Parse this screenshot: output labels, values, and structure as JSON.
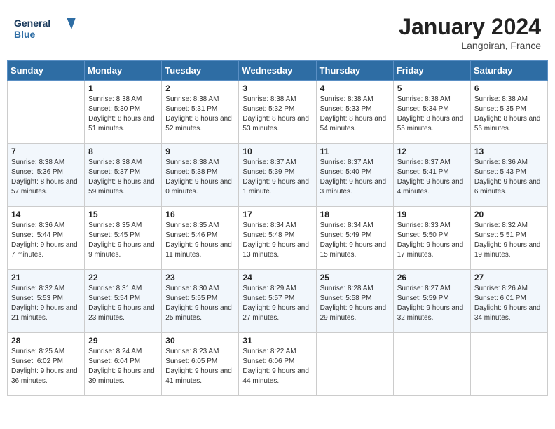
{
  "header": {
    "logo_line1": "General",
    "logo_line2": "Blue",
    "month": "January 2024",
    "location": "Langoiran, France"
  },
  "weekdays": [
    "Sunday",
    "Monday",
    "Tuesday",
    "Wednesday",
    "Thursday",
    "Friday",
    "Saturday"
  ],
  "weeks": [
    [
      {
        "day": "",
        "sunrise": "",
        "sunset": "",
        "daylight": ""
      },
      {
        "day": "1",
        "sunrise": "Sunrise: 8:38 AM",
        "sunset": "Sunset: 5:30 PM",
        "daylight": "Daylight: 8 hours and 51 minutes."
      },
      {
        "day": "2",
        "sunrise": "Sunrise: 8:38 AM",
        "sunset": "Sunset: 5:31 PM",
        "daylight": "Daylight: 8 hours and 52 minutes."
      },
      {
        "day": "3",
        "sunrise": "Sunrise: 8:38 AM",
        "sunset": "Sunset: 5:32 PM",
        "daylight": "Daylight: 8 hours and 53 minutes."
      },
      {
        "day": "4",
        "sunrise": "Sunrise: 8:38 AM",
        "sunset": "Sunset: 5:33 PM",
        "daylight": "Daylight: 8 hours and 54 minutes."
      },
      {
        "day": "5",
        "sunrise": "Sunrise: 8:38 AM",
        "sunset": "Sunset: 5:34 PM",
        "daylight": "Daylight: 8 hours and 55 minutes."
      },
      {
        "day": "6",
        "sunrise": "Sunrise: 8:38 AM",
        "sunset": "Sunset: 5:35 PM",
        "daylight": "Daylight: 8 hours and 56 minutes."
      }
    ],
    [
      {
        "day": "7",
        "sunrise": "Sunrise: 8:38 AM",
        "sunset": "Sunset: 5:36 PM",
        "daylight": "Daylight: 8 hours and 57 minutes."
      },
      {
        "day": "8",
        "sunrise": "Sunrise: 8:38 AM",
        "sunset": "Sunset: 5:37 PM",
        "daylight": "Daylight: 8 hours and 59 minutes."
      },
      {
        "day": "9",
        "sunrise": "Sunrise: 8:38 AM",
        "sunset": "Sunset: 5:38 PM",
        "daylight": "Daylight: 9 hours and 0 minutes."
      },
      {
        "day": "10",
        "sunrise": "Sunrise: 8:37 AM",
        "sunset": "Sunset: 5:39 PM",
        "daylight": "Daylight: 9 hours and 1 minute."
      },
      {
        "day": "11",
        "sunrise": "Sunrise: 8:37 AM",
        "sunset": "Sunset: 5:40 PM",
        "daylight": "Daylight: 9 hours and 3 minutes."
      },
      {
        "day": "12",
        "sunrise": "Sunrise: 8:37 AM",
        "sunset": "Sunset: 5:41 PM",
        "daylight": "Daylight: 9 hours and 4 minutes."
      },
      {
        "day": "13",
        "sunrise": "Sunrise: 8:36 AM",
        "sunset": "Sunset: 5:43 PM",
        "daylight": "Daylight: 9 hours and 6 minutes."
      }
    ],
    [
      {
        "day": "14",
        "sunrise": "Sunrise: 8:36 AM",
        "sunset": "Sunset: 5:44 PM",
        "daylight": "Daylight: 9 hours and 7 minutes."
      },
      {
        "day": "15",
        "sunrise": "Sunrise: 8:35 AM",
        "sunset": "Sunset: 5:45 PM",
        "daylight": "Daylight: 9 hours and 9 minutes."
      },
      {
        "day": "16",
        "sunrise": "Sunrise: 8:35 AM",
        "sunset": "Sunset: 5:46 PM",
        "daylight": "Daylight: 9 hours and 11 minutes."
      },
      {
        "day": "17",
        "sunrise": "Sunrise: 8:34 AM",
        "sunset": "Sunset: 5:48 PM",
        "daylight": "Daylight: 9 hours and 13 minutes."
      },
      {
        "day": "18",
        "sunrise": "Sunrise: 8:34 AM",
        "sunset": "Sunset: 5:49 PM",
        "daylight": "Daylight: 9 hours and 15 minutes."
      },
      {
        "day": "19",
        "sunrise": "Sunrise: 8:33 AM",
        "sunset": "Sunset: 5:50 PM",
        "daylight": "Daylight: 9 hours and 17 minutes."
      },
      {
        "day": "20",
        "sunrise": "Sunrise: 8:32 AM",
        "sunset": "Sunset: 5:51 PM",
        "daylight": "Daylight: 9 hours and 19 minutes."
      }
    ],
    [
      {
        "day": "21",
        "sunrise": "Sunrise: 8:32 AM",
        "sunset": "Sunset: 5:53 PM",
        "daylight": "Daylight: 9 hours and 21 minutes."
      },
      {
        "day": "22",
        "sunrise": "Sunrise: 8:31 AM",
        "sunset": "Sunset: 5:54 PM",
        "daylight": "Daylight: 9 hours and 23 minutes."
      },
      {
        "day": "23",
        "sunrise": "Sunrise: 8:30 AM",
        "sunset": "Sunset: 5:55 PM",
        "daylight": "Daylight: 9 hours and 25 minutes."
      },
      {
        "day": "24",
        "sunrise": "Sunrise: 8:29 AM",
        "sunset": "Sunset: 5:57 PM",
        "daylight": "Daylight: 9 hours and 27 minutes."
      },
      {
        "day": "25",
        "sunrise": "Sunrise: 8:28 AM",
        "sunset": "Sunset: 5:58 PM",
        "daylight": "Daylight: 9 hours and 29 minutes."
      },
      {
        "day": "26",
        "sunrise": "Sunrise: 8:27 AM",
        "sunset": "Sunset: 5:59 PM",
        "daylight": "Daylight: 9 hours and 32 minutes."
      },
      {
        "day": "27",
        "sunrise": "Sunrise: 8:26 AM",
        "sunset": "Sunset: 6:01 PM",
        "daylight": "Daylight: 9 hours and 34 minutes."
      }
    ],
    [
      {
        "day": "28",
        "sunrise": "Sunrise: 8:25 AM",
        "sunset": "Sunset: 6:02 PM",
        "daylight": "Daylight: 9 hours and 36 minutes."
      },
      {
        "day": "29",
        "sunrise": "Sunrise: 8:24 AM",
        "sunset": "Sunset: 6:04 PM",
        "daylight": "Daylight: 9 hours and 39 minutes."
      },
      {
        "day": "30",
        "sunrise": "Sunrise: 8:23 AM",
        "sunset": "Sunset: 6:05 PM",
        "daylight": "Daylight: 9 hours and 41 minutes."
      },
      {
        "day": "31",
        "sunrise": "Sunrise: 8:22 AM",
        "sunset": "Sunset: 6:06 PM",
        "daylight": "Daylight: 9 hours and 44 minutes."
      },
      {
        "day": "",
        "sunrise": "",
        "sunset": "",
        "daylight": ""
      },
      {
        "day": "",
        "sunrise": "",
        "sunset": "",
        "daylight": ""
      },
      {
        "day": "",
        "sunrise": "",
        "sunset": "",
        "daylight": ""
      }
    ]
  ]
}
